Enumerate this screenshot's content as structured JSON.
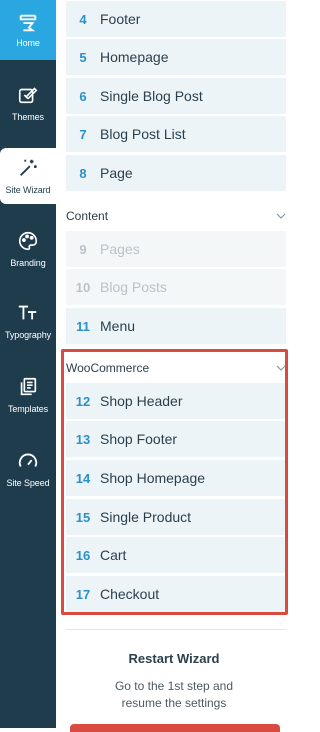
{
  "sidebar": {
    "items": [
      {
        "label": "Home",
        "icon": "home-icon"
      },
      {
        "label": "Themes",
        "icon": "themes-icon"
      },
      {
        "label": "Site Wizard",
        "icon": "magic-wand-icon"
      },
      {
        "label": "Branding",
        "icon": "palette-icon"
      },
      {
        "label": "Typography",
        "icon": "typography-icon"
      },
      {
        "label": "Templates",
        "icon": "templates-icon"
      },
      {
        "label": "Site Speed",
        "icon": "speedometer-icon"
      }
    ]
  },
  "steps_top": [
    {
      "num": "4",
      "label": "Footer"
    },
    {
      "num": "5",
      "label": "Homepage"
    },
    {
      "num": "6",
      "label": "Single Blog Post"
    },
    {
      "num": "7",
      "label": "Blog Post List"
    },
    {
      "num": "8",
      "label": "Page"
    }
  ],
  "content_section": {
    "title": "Content",
    "steps": [
      {
        "num": "9",
        "label": "Pages"
      },
      {
        "num": "10",
        "label": "Blog Posts"
      },
      {
        "num": "11",
        "label": "Menu"
      }
    ]
  },
  "woo_section": {
    "title": "WooCommerce",
    "steps": [
      {
        "num": "12",
        "label": "Shop Header"
      },
      {
        "num": "13",
        "label": "Shop Footer"
      },
      {
        "num": "14",
        "label": "Shop Homepage"
      },
      {
        "num": "15",
        "label": "Single Product"
      },
      {
        "num": "16",
        "label": "Cart"
      },
      {
        "num": "17",
        "label": "Checkout"
      }
    ]
  },
  "restart": {
    "title": "Restart Wizard",
    "desc_line1": "Go to the 1st step and",
    "desc_line2": "resume the settings"
  },
  "colors": {
    "sidebar_bg": "#1f3c4d",
    "home_active": "#2aa7e0",
    "step_number": "#2a91c8",
    "highlight_frame": "#d94a3f"
  }
}
